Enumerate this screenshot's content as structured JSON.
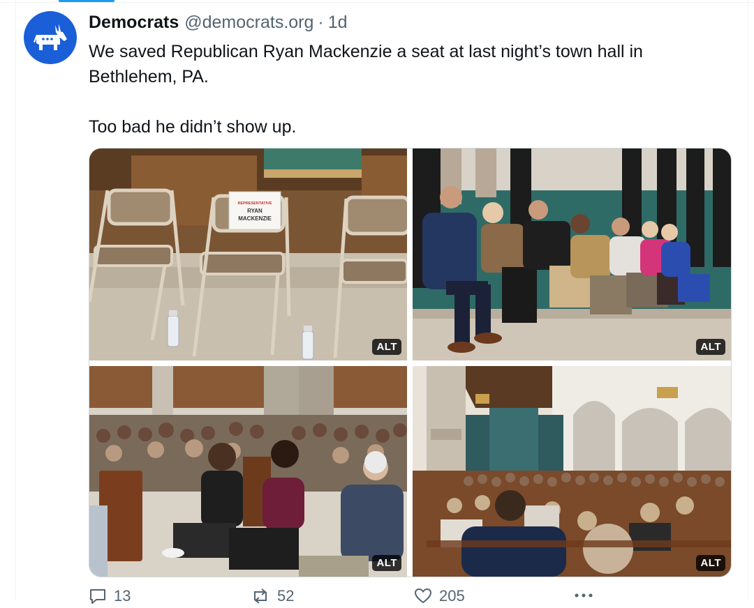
{
  "tweet": {
    "author_name": "Democrats",
    "handle": "@democrats.org",
    "separator": "·",
    "time": "1d",
    "text_line1": "We saved Republican Ryan Mackenzie a seat at last night’s town hall in Bethlehem, PA.",
    "text_line2": "Too bad he didn’t show up."
  },
  "media": {
    "alt_label": "ALT",
    "sign_line1": "REPRESENTATIVE",
    "sign_line2": "RYAN",
    "sign_line3": "MACKENZIE"
  },
  "actions": {
    "replies": "13",
    "reposts": "52",
    "likes": "205"
  },
  "icons": {
    "avatar": "donkey-logo",
    "reply": "reply-icon",
    "repost": "repost-icon",
    "like": "heart-icon",
    "more": "more-icon"
  },
  "colors": {
    "brand_blue": "#1a5fd8",
    "accent": "#1d9bf0",
    "muted_text": "#536471"
  }
}
